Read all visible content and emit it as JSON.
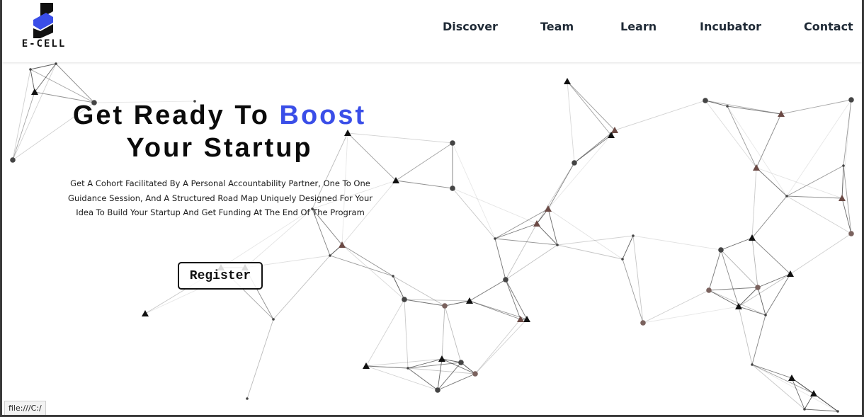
{
  "brand": {
    "logo_text": "E-CELL",
    "accent_color": "#3a4ee8"
  },
  "nav": {
    "items": [
      {
        "label": "Discover"
      },
      {
        "label": "Team"
      },
      {
        "label": "Learn"
      },
      {
        "label": "Incubator"
      },
      {
        "label": "Contact"
      }
    ]
  },
  "hero": {
    "title_part1": "Get Ready To ",
    "title_accent": "Boost",
    "title_line2": "Your Startup",
    "description": "Get A Cohort Facilitated By A Personal Accountability Partner, One To One Guidance Session, And A Structured Road Map Uniquely Designed For Your Idea To Build Your Startup And Get Funding At The End Of The Program",
    "register_label": "Register"
  },
  "status_bar": {
    "text": "file:///C:/"
  }
}
